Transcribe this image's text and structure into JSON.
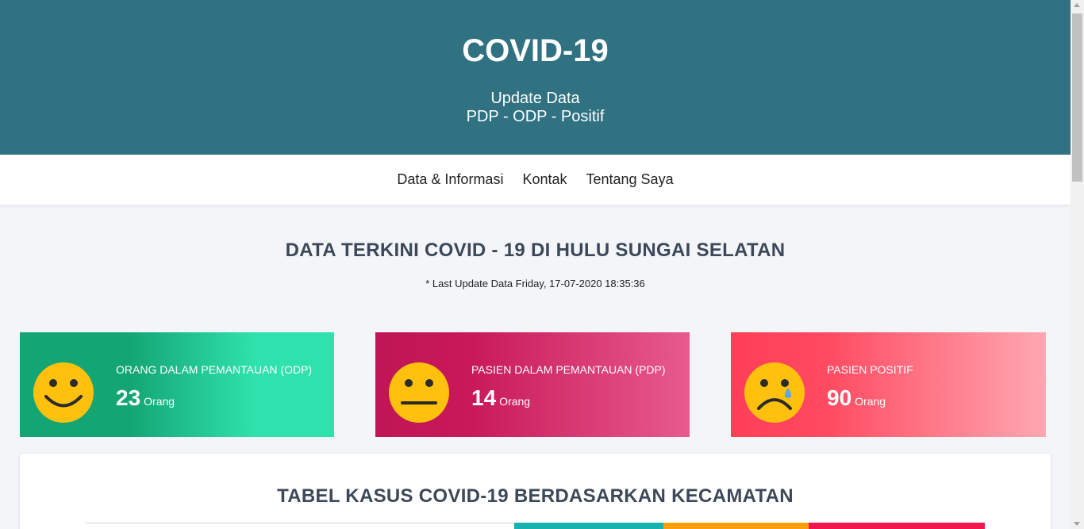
{
  "hero": {
    "title": "COVID-19",
    "subtitle_line1": "Update Data",
    "subtitle_line2": "PDP - ODP - Positif"
  },
  "nav": {
    "items": [
      "Data & Informasi",
      "Kontak",
      "Tentang Saya"
    ]
  },
  "main": {
    "headline": "DATA TERKINI COVID - 19 DI HULU SUNGAI SELATAN",
    "last_update": "* Last Update Data Friday, 17-07-2020 18:35:36"
  },
  "cards": [
    {
      "label": "ORANG DALAM PEMANTAUAN (ODP)",
      "value": "23",
      "unit": "Orang",
      "icon": "smiling-face-icon"
    },
    {
      "label": "PASIEN DALAM PEMANTAUAN (PDP)",
      "value": "14",
      "unit": "Orang",
      "icon": "neutral-face-icon"
    },
    {
      "label": "PASIEN POSITIF",
      "value": "90",
      "unit": "Orang",
      "icon": "crying-face-icon"
    }
  ],
  "table": {
    "title": "TABEL KASUS COVID-19 BERDASARKAN KECAMATAN"
  },
  "colors": {
    "hero": "#307182",
    "odp": "#14a574",
    "pdp": "#c01556",
    "positif": "#ff3e57",
    "emoji": "#ffc10e",
    "table_header_1": "#17b3ae",
    "table_header_2": "#ff9f0e",
    "table_header_3": "#f2184d"
  }
}
